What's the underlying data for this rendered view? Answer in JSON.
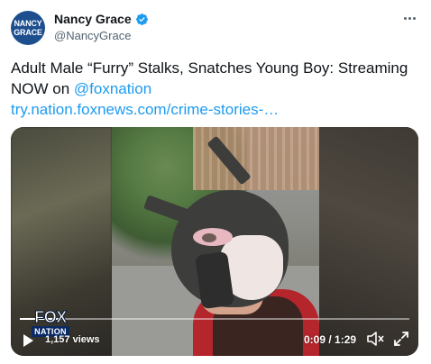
{
  "author": {
    "avatar_line1": "NANCY",
    "avatar_line2": "GRACE",
    "display_name": "Nancy Grace",
    "handle": "@NancyGrace",
    "verified": true
  },
  "tweet": {
    "text_part1": "Adult Male “Furry” Stalks, Snatches Young Boy: Streaming NOW on ",
    "mention": "@foxnation",
    "link": "try.nation.foxnews.com/crime-stories-…"
  },
  "video": {
    "logo_top": "FOX",
    "logo_bottom": "NATION",
    "views": "1,157 views",
    "time": "0:09 / 1:29",
    "progress_fraction": 0.1,
    "icons": [
      "play-icon",
      "mute-icon",
      "fullscreen-icon"
    ]
  },
  "icons": {
    "verified": "verified-badge-icon",
    "more": "more-options-icon"
  },
  "colors": {
    "link": "#1d9bf0",
    "verified": "#1d9bf0",
    "avatar_bg": "#1d4f8f",
    "secondary_text": "#536471"
  }
}
